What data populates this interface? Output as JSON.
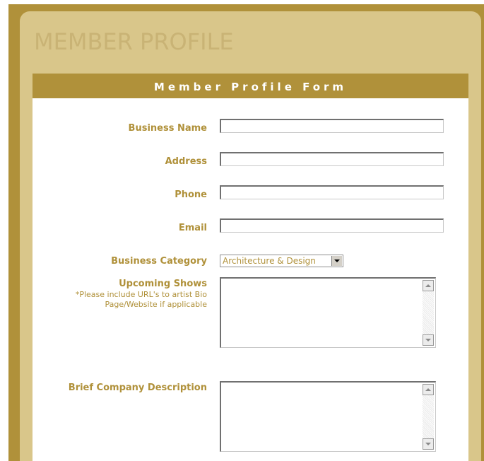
{
  "page": {
    "title": "MEMBER PROFILE"
  },
  "form": {
    "header": "Member Profile Form",
    "fields": {
      "business_name": {
        "label": "Business Name",
        "value": ""
      },
      "address": {
        "label": "Address",
        "value": ""
      },
      "phone": {
        "label": "Phone",
        "value": ""
      },
      "email": {
        "label": "Email",
        "value": ""
      },
      "business_category": {
        "label": "Business Category",
        "selected": "Architecture & Design"
      },
      "upcoming_shows": {
        "label": "Upcoming Shows",
        "note": "*Please include URL's to artist Bio Page/Website if applicable",
        "value": ""
      },
      "brief_description": {
        "label": "Brief Company Description",
        "value": ""
      }
    }
  },
  "colors": {
    "frame": "#b0913a",
    "panel": "#d9c68a",
    "title": "#c9b375",
    "label": "#b0913a"
  },
  "icons": {
    "select_arrow": "chevron-down-icon",
    "scroll_up": "scroll-up-arrow-icon",
    "scroll_down": "scroll-down-arrow-icon"
  }
}
